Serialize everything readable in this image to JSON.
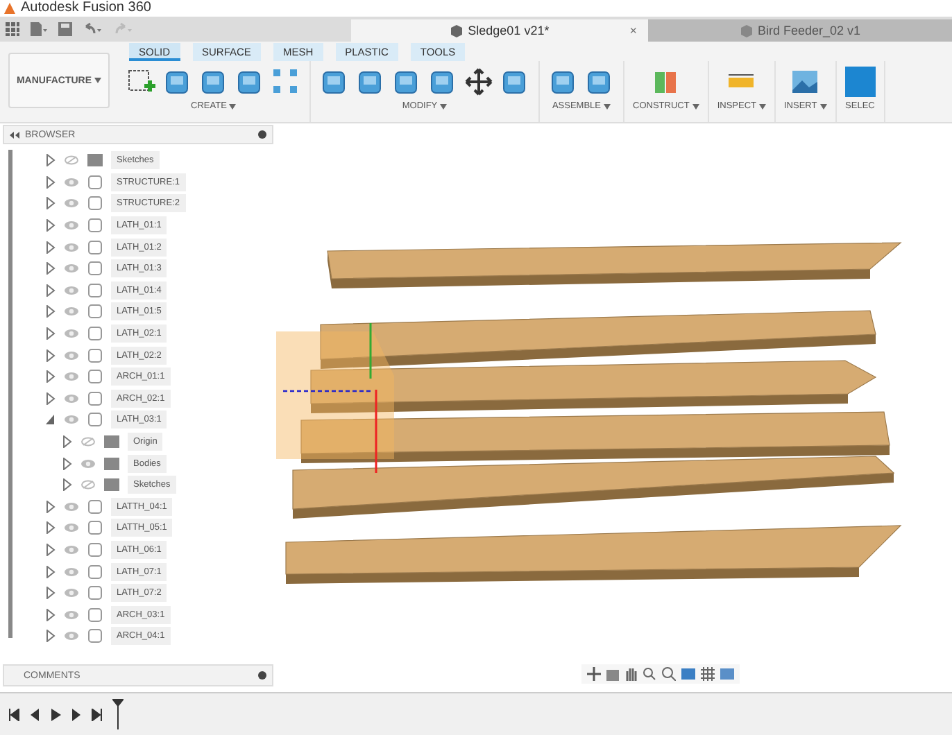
{
  "app_title": "Autodesk Fusion 360",
  "document_tabs": [
    {
      "title": "Sledge01 v21*",
      "selected": true,
      "close": "×"
    },
    {
      "title": "Bird Feeder_02 v1",
      "selected": false
    }
  ],
  "workspace": {
    "label": "MANUFACTURE"
  },
  "ribbon_tabs": [
    {
      "label": "SOLID",
      "selected": true
    },
    {
      "label": "SURFACE",
      "selected": false
    },
    {
      "label": "MESH",
      "selected": false
    },
    {
      "label": "PLASTIC",
      "selected": false
    },
    {
      "label": "TOOLS",
      "selected": false
    }
  ],
  "tool_groups": [
    {
      "label": "CREATE",
      "dropdown": true
    },
    {
      "label": "MODIFY",
      "dropdown": true
    },
    {
      "label": "ASSEMBLE",
      "dropdown": true
    },
    {
      "label": "CONSTRUCT",
      "dropdown": true
    },
    {
      "label": "INSPECT",
      "dropdown": true
    },
    {
      "label": "INSERT",
      "dropdown": true
    },
    {
      "label": "SELEC",
      "dropdown": false
    }
  ],
  "browser": {
    "title": "BROWSER",
    "items": [
      {
        "name": "Sketches",
        "kind": "folder",
        "visible": false,
        "expanded": false
      },
      {
        "name": "STRUCTURE:1",
        "kind": "component",
        "visible": true,
        "expanded": false
      },
      {
        "name": "STRUCTURE:2",
        "kind": "component",
        "visible": true,
        "expanded": false
      },
      {
        "name": "LATH_01:1",
        "kind": "component",
        "visible": true,
        "expanded": false
      },
      {
        "name": "LATH_01:2",
        "kind": "component",
        "visible": true,
        "expanded": false
      },
      {
        "name": "LATH_01:3",
        "kind": "component",
        "visible": true,
        "expanded": false
      },
      {
        "name": "LATH_01:4",
        "kind": "component",
        "visible": true,
        "expanded": false
      },
      {
        "name": "LATH_01:5",
        "kind": "component",
        "visible": true,
        "expanded": false
      },
      {
        "name": "LATH_02:1",
        "kind": "component",
        "visible": true,
        "expanded": false
      },
      {
        "name": "LATH_02:2",
        "kind": "component",
        "visible": true,
        "expanded": false
      },
      {
        "name": "ARCH_01:1",
        "kind": "component",
        "visible": true,
        "expanded": false
      },
      {
        "name": "ARCH_02:1",
        "kind": "component",
        "visible": true,
        "expanded": false
      },
      {
        "name": "LATH_03:1",
        "kind": "component",
        "visible": true,
        "expanded": true,
        "children": [
          {
            "name": "Origin",
            "kind": "folder",
            "visible": false,
            "expanded": false
          },
          {
            "name": "Bodies",
            "kind": "folder",
            "visible": true,
            "expanded": false
          },
          {
            "name": "Sketches",
            "kind": "folder",
            "visible": false,
            "expanded": false
          }
        ]
      },
      {
        "name": "LATTH_04:1",
        "kind": "component",
        "visible": true,
        "expanded": false
      },
      {
        "name": "LATTH_05:1",
        "kind": "component",
        "visible": true,
        "expanded": false
      },
      {
        "name": "LATH_06:1",
        "kind": "component",
        "visible": true,
        "expanded": false
      },
      {
        "name": "LATH_07:1",
        "kind": "component",
        "visible": true,
        "expanded": false
      },
      {
        "name": "LATH_07:2",
        "kind": "component",
        "visible": true,
        "expanded": false
      },
      {
        "name": "ARCH_03:1",
        "kind": "component",
        "visible": true,
        "expanded": false
      },
      {
        "name": "ARCH_04:1",
        "kind": "component",
        "visible": true,
        "expanded": false
      }
    ]
  },
  "comments": {
    "title": "COMMENTS"
  }
}
